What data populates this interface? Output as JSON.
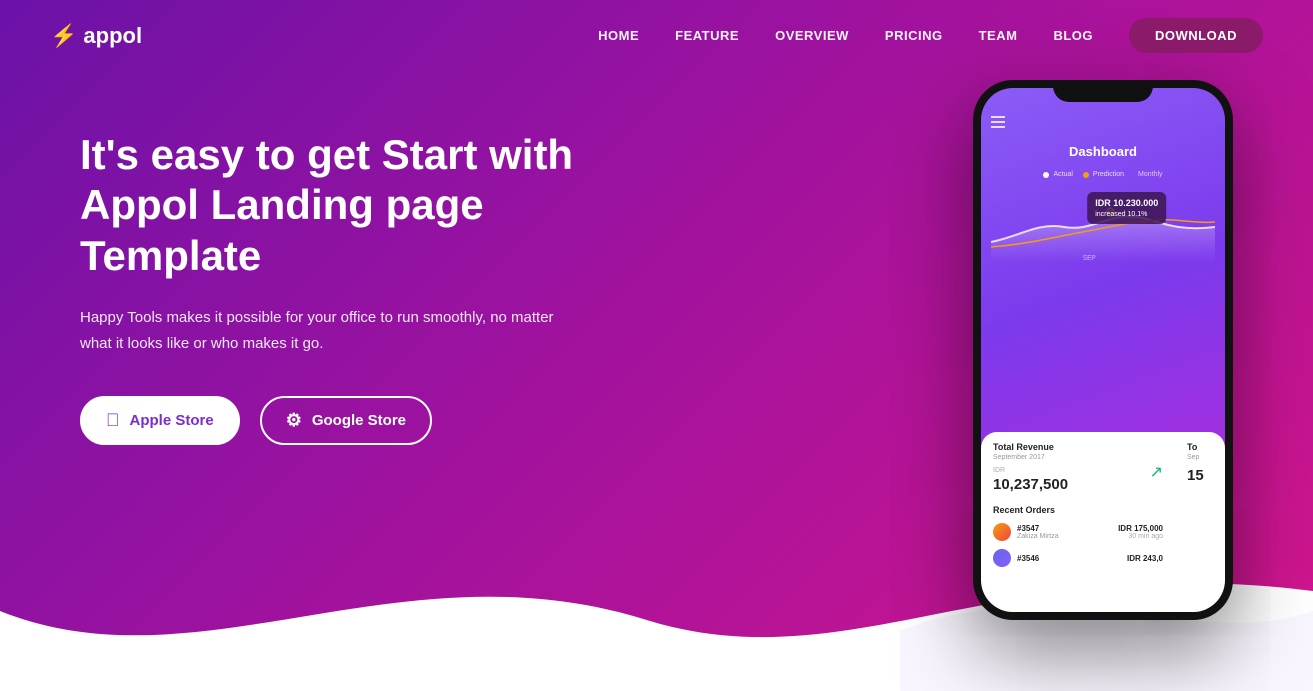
{
  "brand": {
    "name": "appol",
    "logo_icon": "⚡"
  },
  "nav": {
    "links": [
      {
        "label": "HOME",
        "href": "#"
      },
      {
        "label": "FEATURE",
        "href": "#"
      },
      {
        "label": "OVERVIEW",
        "href": "#"
      },
      {
        "label": "PRICING",
        "href": "#"
      },
      {
        "label": "TEAM",
        "href": "#"
      },
      {
        "label": "BLOG",
        "href": "#"
      }
    ],
    "download_label": "DOWNLOAD"
  },
  "hero": {
    "title": "It's easy to get Start with Appol Landing page Template",
    "subtitle": "Happy Tools makes it possible for your office to run smoothly, no matter what it looks like or who makes it go.",
    "btn_apple": "Apple Store",
    "btn_google": "Google Store"
  },
  "phone": {
    "dashboard_title": "Dashboard",
    "legend_actual": "Actual",
    "legend_prediction": "Prediction",
    "legend_monthly": "Monthly",
    "tooltip_amount": "IDR 10.230.000",
    "tooltip_sub": "increased 10.1%",
    "card1_title": "Total Revenue",
    "card1_date": "September 2017",
    "card1_label": "IDR",
    "card1_amount": "10,237,500",
    "card2_title": "To",
    "card2_date": "Sep",
    "card2_amount": "15",
    "orders_title": "Recent Orders",
    "orders": [
      {
        "id": "#3547",
        "name": "Zakiza Mirtza",
        "amount": "IDR 175,000",
        "time": "30 min ago"
      },
      {
        "id": "#3546",
        "name": "",
        "amount": "IDR 243,0",
        "time": ""
      }
    ]
  }
}
